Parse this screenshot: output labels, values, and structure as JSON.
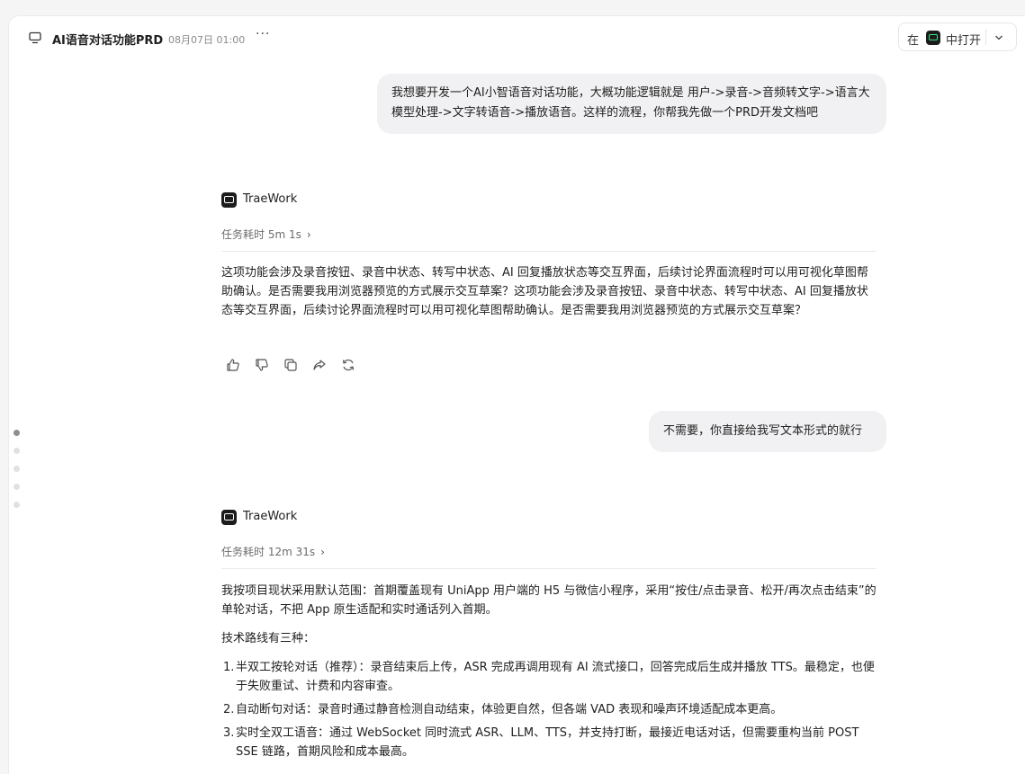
{
  "header": {
    "title": "AI语音对话功能PRD",
    "timestamp": "08月07日 01:00",
    "more_label": "···",
    "open_prefix": "在",
    "open_suffix": "中打开"
  },
  "messages": {
    "user1": "我想要开发一个AI小智语音对话功能，大概功能逻辑就是 用户->录音->音频转文字->语言大模型处理->文字转语音->播放语音。这样的流程，你帮我先做一个PRD开发文档吧",
    "agent1": {
      "name": "TraeWork",
      "task_time": "任务耗时 5m 1s",
      "text": "这项功能会涉及录音按钮、录音中状态、转写中状态、AI 回复播放状态等交互界面，后续讨论界面流程时可以用可视化草图帮助确认。是否需要我用浏览器预览的方式展示交互草案？这项功能会涉及录音按钮、录音中状态、转写中状态、AI 回复播放状态等交互界面，后续讨论界面流程时可以用可视化草图帮助确认。是否需要我用浏览器预览的方式展示交互草案？"
    },
    "user2": "不需要，你直接给我写文本形式的就行",
    "agent2": {
      "name": "TraeWork",
      "task_time": "任务耗时 12m 31s",
      "intro": "我按项目现状采用默认范围：首期覆盖现有 UniApp 用户端的 H5 与微信小程序，采用“按住/点击录音、松开/再次点击结束”的单轮对话，不把 App 原生适配和实时通话列入首期。",
      "routes_title": "技术路线有三种：",
      "routes": [
        {
          "num": "1.",
          "text": "半双工按轮对话（推荐）：录音结束后上传，ASR 完成再调用现有 AI 流式接口，回答完成后生成并播放 TTS。最稳定，也便于失败重试、计费和内容审查。"
        },
        {
          "num": "2.",
          "text": "自动断句对话：录音时通过静音检测自动结束，体验更自然，但各端 VAD 表现和噪声环境适配成本更高。"
        },
        {
          "num": "3.",
          "text": "实时全双工语音：通过 WebSocket 同时流式 ASR、LLM、TTS，并支持打断，最接近电话对话，但需要重构当前 POST SSE 链路，首期风险和成本最高。"
        }
      ]
    }
  }
}
